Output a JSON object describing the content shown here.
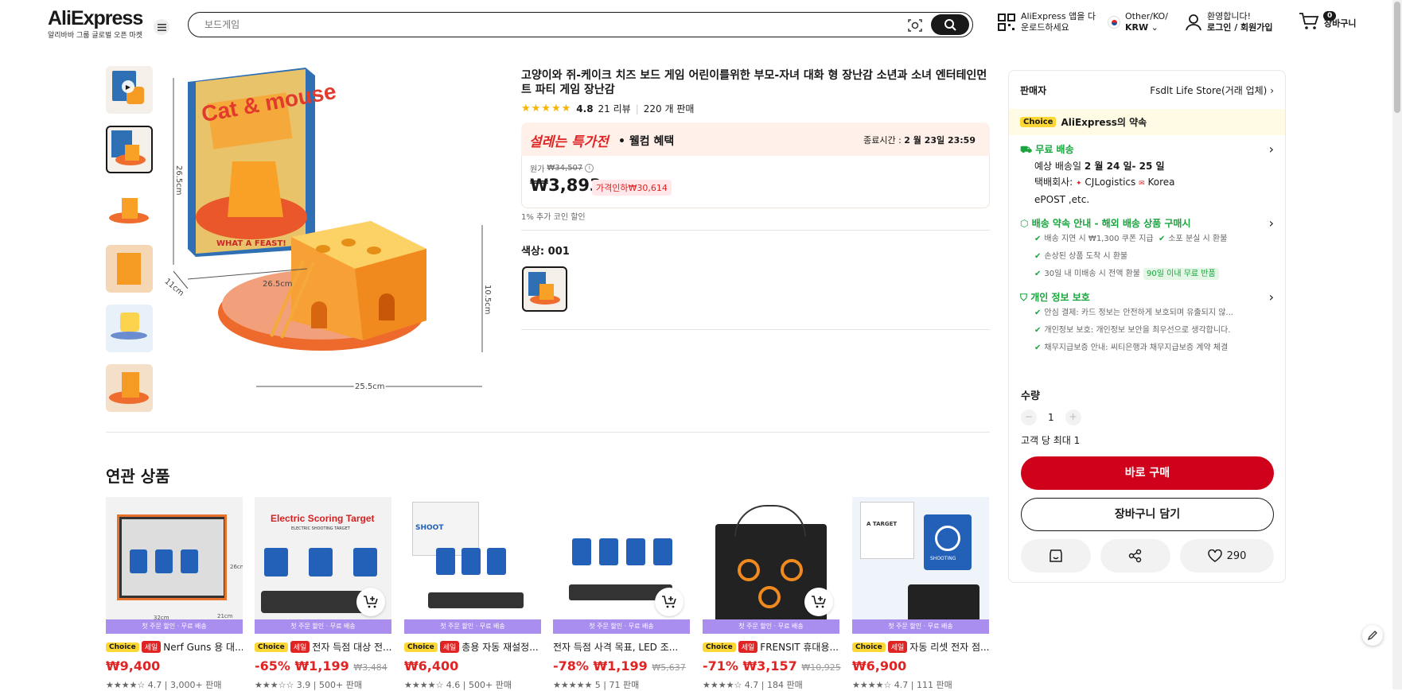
{
  "header": {
    "logo": "AliExpress",
    "logo_sub": "알리바바 그룹 글로벌 오픈 마켓",
    "search_placeholder": "보드게임",
    "app_line1": "AliExpress 앱을 다",
    "app_line2": "운로드하세요",
    "region_line1": "Other/KO/",
    "region_line2": "KRW",
    "account_line1": "환영합니다!",
    "account_line2": "로그인 / 회원가입",
    "cart_count": "0",
    "cart_label": "장바구니"
  },
  "product": {
    "title": "고양이와 쥐-케이크 치즈 보드 게임 어린이를위한 부모-자녀 대화 형 장난감 소년과 소녀 엔터테인먼트 파티 게임 장난감",
    "rating": "4.8",
    "reviews": "21 리뷰",
    "sold": "220 개 판매",
    "deal_title": "설레는 특가전",
    "deal_sub": "• 웰컴 혜택",
    "end_label": "종료시간 :",
    "end_time": "2 월 23일 23:59",
    "orig_label": "원가",
    "orig_price": "₩34,507",
    "price": "₩3,893",
    "discount": "가격인하₩30,614",
    "coin": "1% 추가 코인 할인",
    "color_label": "색상: 001",
    "box_title": "Cat & mouse",
    "box_feast": "WHAT A FEAST!",
    "dim_height": "26.5cm",
    "dim_depth": "11cm",
    "dim_width": "26.5cm",
    "dim_toy_h": "10.5cm",
    "dim_toy_w": "25.5cm"
  },
  "related": {
    "title": "연관 상품",
    "banner": "첫 주문 할인 · 무료 배송",
    "items": [
      {
        "choice": "Choice",
        "sale": "세일",
        "name": "Nerf Guns 용 대...",
        "price": "₩9,400",
        "discount": "",
        "orig": "",
        "rating": "★★★★☆ 4.7 | 3,000+ 판매",
        "art_title": "",
        "art_sub": "",
        "size_a": "32cm",
        "size_b": "21cm",
        "size_c": "26cm"
      },
      {
        "choice": "Choice",
        "sale": "세일",
        "name": "전자 득점 대상 전...",
        "price": "₩1,199",
        "discount": "-65%",
        "orig": "₩3,484",
        "rating": "★★★☆☆ 3.9 | 500+ 판매",
        "art_title": "Electric Scoring Target",
        "art_sub": "ELECTRIC SHOOTING TARGET",
        "size_a": "",
        "size_b": "",
        "size_c": ""
      },
      {
        "choice": "Choice",
        "sale": "세일",
        "name": "총용 자동 재설정...",
        "price": "₩6,400",
        "discount": "",
        "orig": "",
        "rating": "★★★★☆ 4.6 | 500+ 판매",
        "art_title": "SHOOT",
        "art_sub": "",
        "size_a": "",
        "size_b": "",
        "size_c": ""
      },
      {
        "choice": "",
        "sale": "",
        "name": "전자 득점 사격 목표, LED 조...",
        "price": "₩1,199",
        "discount": "-78%",
        "orig": "₩5,637",
        "rating": "★★★★★ 5 | 71 판매",
        "art_title": "",
        "art_sub": "",
        "size_a": "",
        "size_b": "",
        "size_c": ""
      },
      {
        "choice": "Choice",
        "sale": "세일",
        "name": "FRENSIT 휴대용...",
        "price": "₩3,157",
        "discount": "-71%",
        "orig": "₩10,925",
        "rating": "★★★★☆ 4.7 | 184 판매",
        "art_title": "",
        "art_sub": "",
        "size_a": "",
        "size_b": "",
        "size_c": ""
      },
      {
        "choice": "Choice",
        "sale": "세일",
        "name": "자동 리셋 전자 점...",
        "price": "₩6,900",
        "discount": "",
        "orig": "",
        "rating": "★★★★☆ 4.7 | 111 판매",
        "art_title": "A TARGET",
        "art_sub": "SHOOTING",
        "size_a": "",
        "size_b": "",
        "size_c": ""
      }
    ]
  },
  "sidebar": {
    "seller_label": "판매자",
    "seller_name": "Fsdlt Life Store(거래 업체)",
    "choice": "Choice",
    "promise": "AliExpress의 약속",
    "free_ship": "무료 배송",
    "eta_prefix": "예상 배송일",
    "eta": "2 월 24 일- 25 일",
    "carrier_label": "택배회사:",
    "carrier1": "CJLogistics",
    "carrier2": "Korea",
    "carrier3": "ePOST ,etc.",
    "guarantee_title": "배송 약속 안내 - 해외 배송 상품 구매시",
    "g1": "배송 지연 시 ₩1,300 쿠폰 지급",
    "g2": "소포 분실 시 환불",
    "g3": "손상된 상품 도착 시 환불",
    "g4": "30일 내 미배송 시 전액 환불",
    "g4_badge": "90일 이내 무료 반품",
    "privacy_title": "개인 정보 보호",
    "p1": "안심 결제: 카드 정보는 안전하게 보호되며 유출되지 않...",
    "p2": "개인정보 보호: 개인정보 보안을 최우선으로 생각합니다.",
    "p3": "채무지급보증 안내: 씨티은행과 채무지급보증 계약 체결",
    "qty_label": "수량",
    "qty_value": "1",
    "qty_max": "고객 당 최대 1",
    "buy_now": "바로 구매",
    "add_cart": "장바구니 담기",
    "wish_count": "290"
  },
  "colors": {
    "accent_red": "#d0021b",
    "price_red": "#e02424",
    "green": "#18a53d",
    "choice_yellow": "#fdd835",
    "banner_purple": "#a98ef0"
  }
}
